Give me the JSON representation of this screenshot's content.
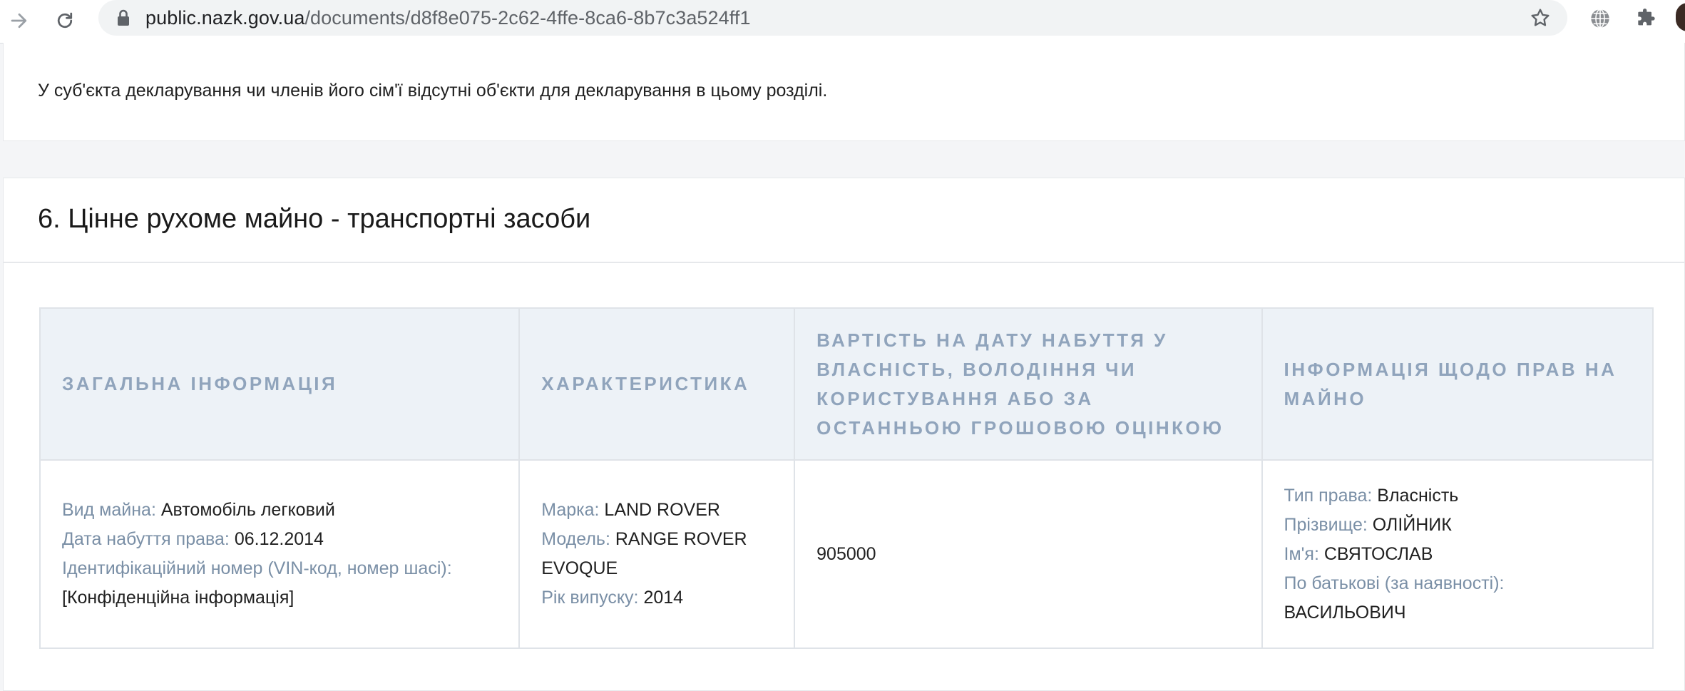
{
  "browser": {
    "url_host": "public.nazk.gov.ua",
    "url_path": "/documents/d8f8e075-2c62-4ffe-8ca6-8b7c3a524ff1"
  },
  "notice": {
    "text": "У суб'єкта декларування чи членів його сім'ї відсутні об'єкти для декларування в цьому розділі."
  },
  "section": {
    "title": "6. Цінне рухоме майно - транспортні засоби"
  },
  "table": {
    "headers": [
      "ЗАГАЛЬНА ІНФОРМАЦІЯ",
      "ХАРАКТЕРИСТИКА",
      "ВАРТІСТЬ НА ДАТУ НАБУТТЯ У ВЛАСНІСТЬ, ВОЛОДІННЯ ЧИ КОРИСТУВАННЯ АБО ЗА ОСТАННЬОЮ ГРОШОВОЮ ОЦІНКОЮ",
      "ІНФОРМАЦІЯ ЩОДО ПРАВ НА МАЙНО"
    ],
    "row": {
      "general": {
        "type_label": "Вид майна:",
        "type_value": "Автомобіль легковий",
        "date_label": "Дата набуття права:",
        "date_value": "06.12.2014",
        "vin_label": "Ідентифікаційний номер (VIN-код, номер шасі):",
        "vin_value": "[Конфіденційна інформація]"
      },
      "specs": {
        "brand_label": "Марка:",
        "brand_value": "LAND ROVER",
        "model_label": "Модель:",
        "model_value": "RANGE ROVER EVOQUE",
        "year_label": "Рік випуску:",
        "year_value": "2014"
      },
      "value": "905000",
      "rights": {
        "right_label": "Тип права:",
        "right_value": "Власність",
        "surname_label": "Прізвище:",
        "surname_value": "ОЛІЙНИК",
        "name_label": "Ім'я:",
        "name_value": "СВЯТОСЛАВ",
        "patronymic_label": "По батькові (за наявності):",
        "patronymic_value": "ВАСИЛЬОВИЧ"
      }
    }
  },
  "icons": {
    "forward": "arrow-right-icon",
    "reload": "reload-icon",
    "lock": "lock-icon",
    "bookmark": "star-icon",
    "extension1": "globe-icon",
    "extension2": "puzzle-icon"
  },
  "colors": {
    "header_bg": "#edf2f7",
    "header_text": "#90a4bc",
    "label_text": "#7a8fa6"
  }
}
